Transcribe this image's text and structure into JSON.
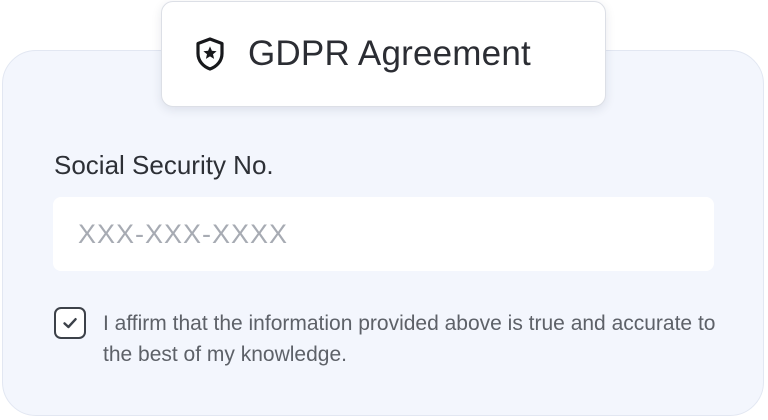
{
  "header": {
    "title": "GDPR Agreement",
    "icon": "shield-star-icon"
  },
  "form": {
    "ssn_label": "Social Security No.",
    "ssn_placeholder": "XXX-XXX-XXXX",
    "ssn_value": "",
    "consent_checked": true,
    "consent_text": "I affirm that the information provided above is true and accurate to the best of my knowledge.",
    "checkbox_icon": "checkmark-icon"
  },
  "colors": {
    "card_background": "#f3f6fd",
    "card_border": "#e2e7f2",
    "text_primary": "#2d3036",
    "text_secondary": "#5d6168",
    "placeholder": "#a7abb3"
  }
}
